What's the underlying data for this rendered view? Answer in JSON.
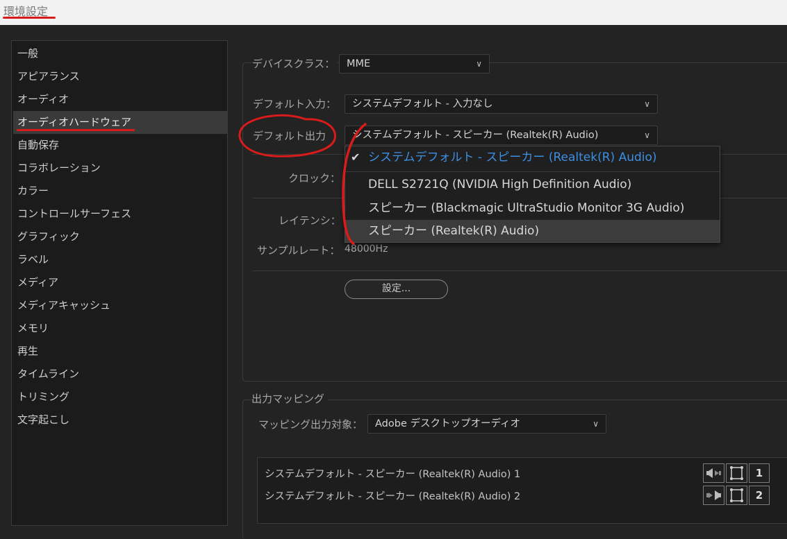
{
  "window": {
    "title": "環境設定"
  },
  "sidebar": {
    "selected_index": 3,
    "items": [
      "一般",
      "アピアランス",
      "オーディオ",
      "オーディオハードウェア",
      "自動保存",
      "コラボレーション",
      "カラー",
      "コントロールサーフェス",
      "グラフィック",
      "ラベル",
      "メディア",
      "メディアキャッシュ",
      "メモリ",
      "再生",
      "タイムライン",
      "トリミング",
      "文字起こし"
    ]
  },
  "audio_hardware": {
    "device_class": {
      "label": "デバイスクラス：",
      "value": "MME"
    },
    "default_input": {
      "label": "デフォルト入力：",
      "value": "システムデフォルト - 入力なし"
    },
    "default_output": {
      "label": "デフォルト出力",
      "value": "システムデフォルト - スピーカー (Realtek(R) Audio)"
    },
    "clock": {
      "label": "クロック："
    },
    "latency": {
      "label": "レイテンシ："
    },
    "sample_rate": {
      "label": "サンプルレート：",
      "value": "48000Hz"
    },
    "settings_button": "設定..."
  },
  "output_menu": {
    "items": [
      {
        "label": "システムデフォルト - スピーカー (Realtek(R) Audio)",
        "checked": true
      },
      {
        "label": "DELL S2721Q (NVIDIA High Definition Audio)",
        "checked": false
      },
      {
        "label": "スピーカー (Blackmagic UltraStudio Monitor 3G Audio)",
        "checked": false
      },
      {
        "label": "スピーカー (Realtek(R) Audio)",
        "checked": false,
        "hovered": true
      }
    ],
    "check_glyph": "✔"
  },
  "output_mapping": {
    "heading": "出力マッピング",
    "target_label": "マッピング出力対象：",
    "target_value": "Adobe デスクトップオーディオ",
    "channels": [
      {
        "label": "システムデフォルト - スピーカー (Realtek(R) Audio) 1",
        "number": "1",
        "icon": "speaker-left-icon"
      },
      {
        "label": "システムデフォルト - スピーカー (Realtek(R) Audio) 2",
        "number": "2",
        "icon": "speaker-right-icon"
      }
    ]
  },
  "colors": {
    "accent": "#3d8fe4",
    "annotation": "#d81b1b"
  }
}
